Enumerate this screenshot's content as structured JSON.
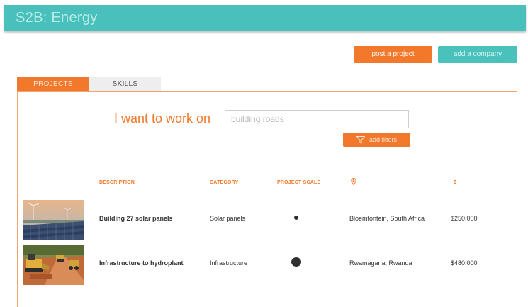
{
  "header": {
    "title": "S2B: Energy"
  },
  "actions": {
    "post_project": "post a project",
    "add_company": "add a company"
  },
  "tabs": [
    {
      "label": "PROJECTS",
      "active": true
    },
    {
      "label": "SKILLS",
      "active": false
    }
  ],
  "search": {
    "label": "I want to work on",
    "placeholder": "building roads",
    "filters_label": "add filters"
  },
  "table": {
    "columns": {
      "description": "DESCRIPTION",
      "category": "CATEGORY",
      "scale": "PROJECT SCALE",
      "location_icon": "location-pin-icon",
      "cost": "$"
    },
    "rows": [
      {
        "image": "solar-panels-photo",
        "description": "Building 27 solar panels",
        "category": "Solar panels",
        "scale": "small",
        "location": "Bloemfontein, South Africa",
        "cost": "$250,000"
      },
      {
        "image": "construction-site-photo",
        "description": "Infrastructure to hydroplant",
        "category": "Infrastructure",
        "scale": "large",
        "location": "Rwamagana, Rwanda",
        "cost": "$480,000"
      }
    ]
  },
  "colors": {
    "teal": "#49c0bb",
    "orange": "#f2782b"
  }
}
